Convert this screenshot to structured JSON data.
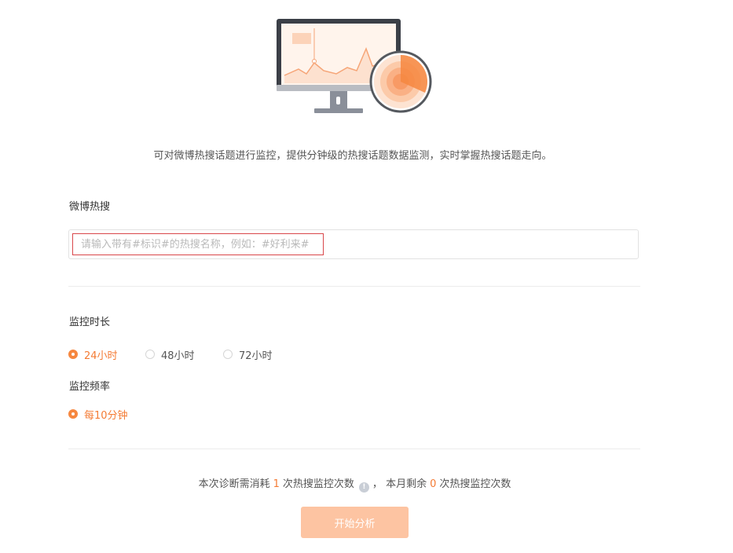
{
  "intro_text": "可对微博热搜话题进行监控，提供分钟级的热搜话题数据监测，实时掌握热搜话题走向。",
  "weibo_section": {
    "label": "微博热搜",
    "input_placeholder": "请输入带有#标识#的热搜名称，例如：#好利来#",
    "input_value": ""
  },
  "duration_section": {
    "label": "监控时长",
    "options": [
      {
        "label": "24小时",
        "selected": true
      },
      {
        "label": "48小时",
        "selected": false
      },
      {
        "label": "72小时",
        "selected": false
      }
    ]
  },
  "frequency_section": {
    "label": "监控频率",
    "options": [
      {
        "label": "每10分钟",
        "selected": true
      }
    ]
  },
  "cost": {
    "prefix": "本次诊断需消耗",
    "consume_count": "1",
    "middle": "次热搜监控次数",
    "info_icon": "!",
    "separator": "，",
    "remain_prefix": "本月剩余",
    "remain_count": "0",
    "suffix": "次热搜监控次数"
  },
  "start_button": {
    "label": "开始分析"
  },
  "colors": {
    "accent": "#f47b34",
    "button_disabled": "#fdc4a2",
    "input_highlight": "#d9474b"
  },
  "icons": {
    "illustration": "monitor-radar-illustration",
    "info": "info-icon"
  }
}
